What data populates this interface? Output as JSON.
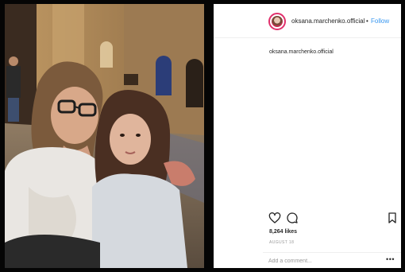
{
  "post": {
    "header": {
      "username": "oksana.marchenko.official",
      "separator": "•",
      "follow_label": "Follow"
    },
    "caption": {
      "username": "oksana.marchenko.official"
    },
    "actions": {
      "like_icon": "heart-icon",
      "comment_icon": "comment-icon",
      "save_icon": "bookmark-icon"
    },
    "likes_text": "8,264 likes",
    "date_text": "AUGUST 18",
    "comment": {
      "placeholder": "Add a comment...",
      "value": "",
      "more_label": "•••"
    }
  },
  "colors": {
    "link": "#3897f0",
    "text": "#262626",
    "muted": "#999999",
    "story_ring": "#e1306c",
    "background": "#050505"
  }
}
